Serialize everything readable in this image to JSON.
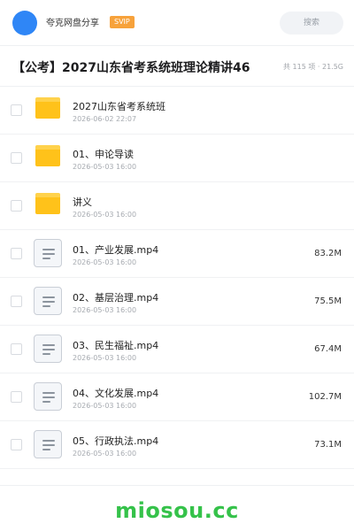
{
  "header": {
    "username": "夸克网盘分享",
    "badge": "SVIP",
    "search_label": "搜索",
    "avatar_color": "#2f86f6"
  },
  "share": {
    "title": "【公考】2027山东省考系统班理论精讲46",
    "meta": "共 115 项 · 21.5G"
  },
  "files": [
    {
      "type": "folder",
      "icon": "folder-icon",
      "name": "2027山东省考系统班",
      "date": "2026-06-02 22:07",
      "size": ""
    },
    {
      "type": "folder",
      "icon": "folder-icon",
      "name": "01、申论导读",
      "date": "2026-05-03 16:00",
      "size": ""
    },
    {
      "type": "folder",
      "icon": "folder-icon",
      "name": "讲义",
      "date": "2026-05-03 16:00",
      "size": ""
    },
    {
      "type": "file",
      "icon": "video-file-icon",
      "name": "01、产业发展.mp4",
      "date": "2026-05-03 16:00",
      "size": "83.2M"
    },
    {
      "type": "file",
      "icon": "video-file-icon",
      "name": "02、基层治理.mp4",
      "date": "2026-05-03 16:00",
      "size": "75.5M"
    },
    {
      "type": "file",
      "icon": "video-file-icon",
      "name": "03、民生福祉.mp4",
      "date": "2026-05-03 16:00",
      "size": "67.4M"
    },
    {
      "type": "file",
      "icon": "video-file-icon",
      "name": "04、文化发展.mp4",
      "date": "2026-05-03 16:00",
      "size": "102.7M"
    },
    {
      "type": "file",
      "icon": "video-file-icon",
      "name": "05、行政执法.mp4",
      "date": "2026-05-03 16:00",
      "size": "73.1M"
    }
  ],
  "footer": {
    "watermark": "miosou.cc",
    "watermark_color": "#35c24a"
  },
  "colors": {
    "folder": "#ffc21a",
    "badge": "#f7a23b"
  }
}
